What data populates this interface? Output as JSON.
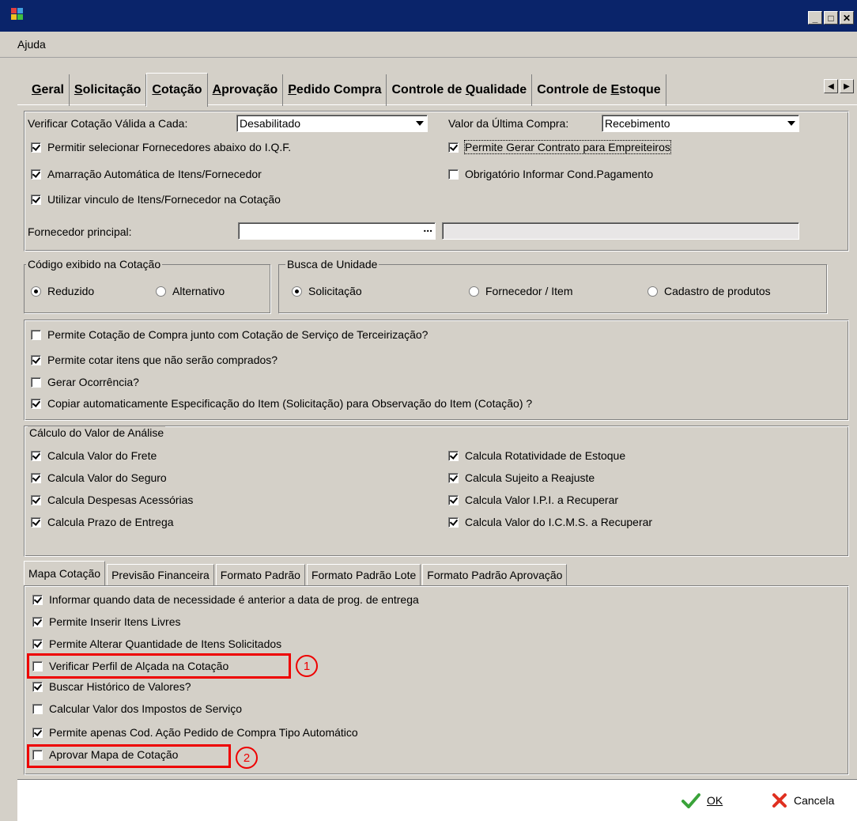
{
  "menu": {
    "ajuda": "Ajuda"
  },
  "window": {
    "min": "_",
    "max": "□",
    "close": "✕"
  },
  "tabs": [
    {
      "label": "Geral",
      "u": "G"
    },
    {
      "label": "Solicitação",
      "u": "S"
    },
    {
      "label": "Cotação",
      "u": "C"
    },
    {
      "label": "Aprovação",
      "u": "A"
    },
    {
      "label": "Pedido Compra",
      "u": "P"
    },
    {
      "label": "Controle de Qualidade",
      "u": "Q"
    },
    {
      "label": "Controle de Estoque",
      "u": "E"
    }
  ],
  "top": {
    "verificar_label": "Verificar Cotação Válida a Cada:",
    "verificar_value": "Desabilitado",
    "valor_label": "Valor da Última Compra:",
    "valor_value": "Recebimento",
    "cb1": "Permitir selecionar Fornecedores abaixo do I.Q.F.",
    "cb2": "Amarração Automática de Itens/Fornecedor",
    "cb3": "Utilizar vinculo de Itens/Fornecedor na Cotação",
    "cb4": "Permite Gerar Contrato para Empreiteiros",
    "cb5": "Obrigatório Informar Cond.Pagamento",
    "fornecedor_label": "Fornecedor principal:",
    "ellipsis": "..."
  },
  "codigo": {
    "legend": "Código exibido na Cotação",
    "r1": "Reduzido",
    "r2": "Alternativo"
  },
  "busca": {
    "legend": "Busca de Unidade",
    "r1": "Solicitação",
    "r2": "Fornecedor / Item",
    "r3": "Cadastro de produtos"
  },
  "opts": {
    "c1": "Permite Cotação de Compra junto com Cotação de Serviço de Terceirização?",
    "c2": "Permite cotar itens que não serão comprados?",
    "c3": "Gerar Ocorrência?",
    "c4": "Copiar automaticamente Especificação do Item (Solicitação) para Observação do Item (Cotação) ?"
  },
  "calculo": {
    "legend": "Cálculo do Valor de Análise",
    "l1": "Calcula Valor do Frete",
    "l2": "Calcula Valor do Seguro",
    "l3": "Calcula Despesas Acessórias",
    "l4": "Calcula Prazo de Entrega",
    "r1": "Calcula Rotatividade de Estoque",
    "r2": "Calcula Sujeito a Reajuste",
    "r3": "Calcula Valor I.P.I. a Recuperar",
    "r4": "Calcula Valor do I.C.M.S. a Recuperar"
  },
  "subtabs": [
    "Mapa Cotação",
    "Previsão Financeira",
    "Formato Padrão",
    "Formato Padrão Lote",
    "Formato Padrão Aprovação"
  ],
  "mapa": {
    "m1": "Informar quando data de necessidade é anterior a data de prog. de entrega",
    "m2": "Permite Inserir Itens Livres",
    "m3": "Permite Alterar Quantidade de Itens Solicitados",
    "m4": "Verificar Perfil de Alçada na Cotação",
    "m5": "Buscar Histórico de Valores?",
    "m6": "Calcular Valor dos Impostos de Serviço",
    "m7": "Permite apenas Cod. Ação Pedido de Compra Tipo Automático",
    "m8": "Aprovar Mapa de Cotação"
  },
  "annotations": {
    "a1": "1",
    "a2": "2"
  },
  "buttons": {
    "ok": "OK",
    "cancel": "Cancela"
  }
}
